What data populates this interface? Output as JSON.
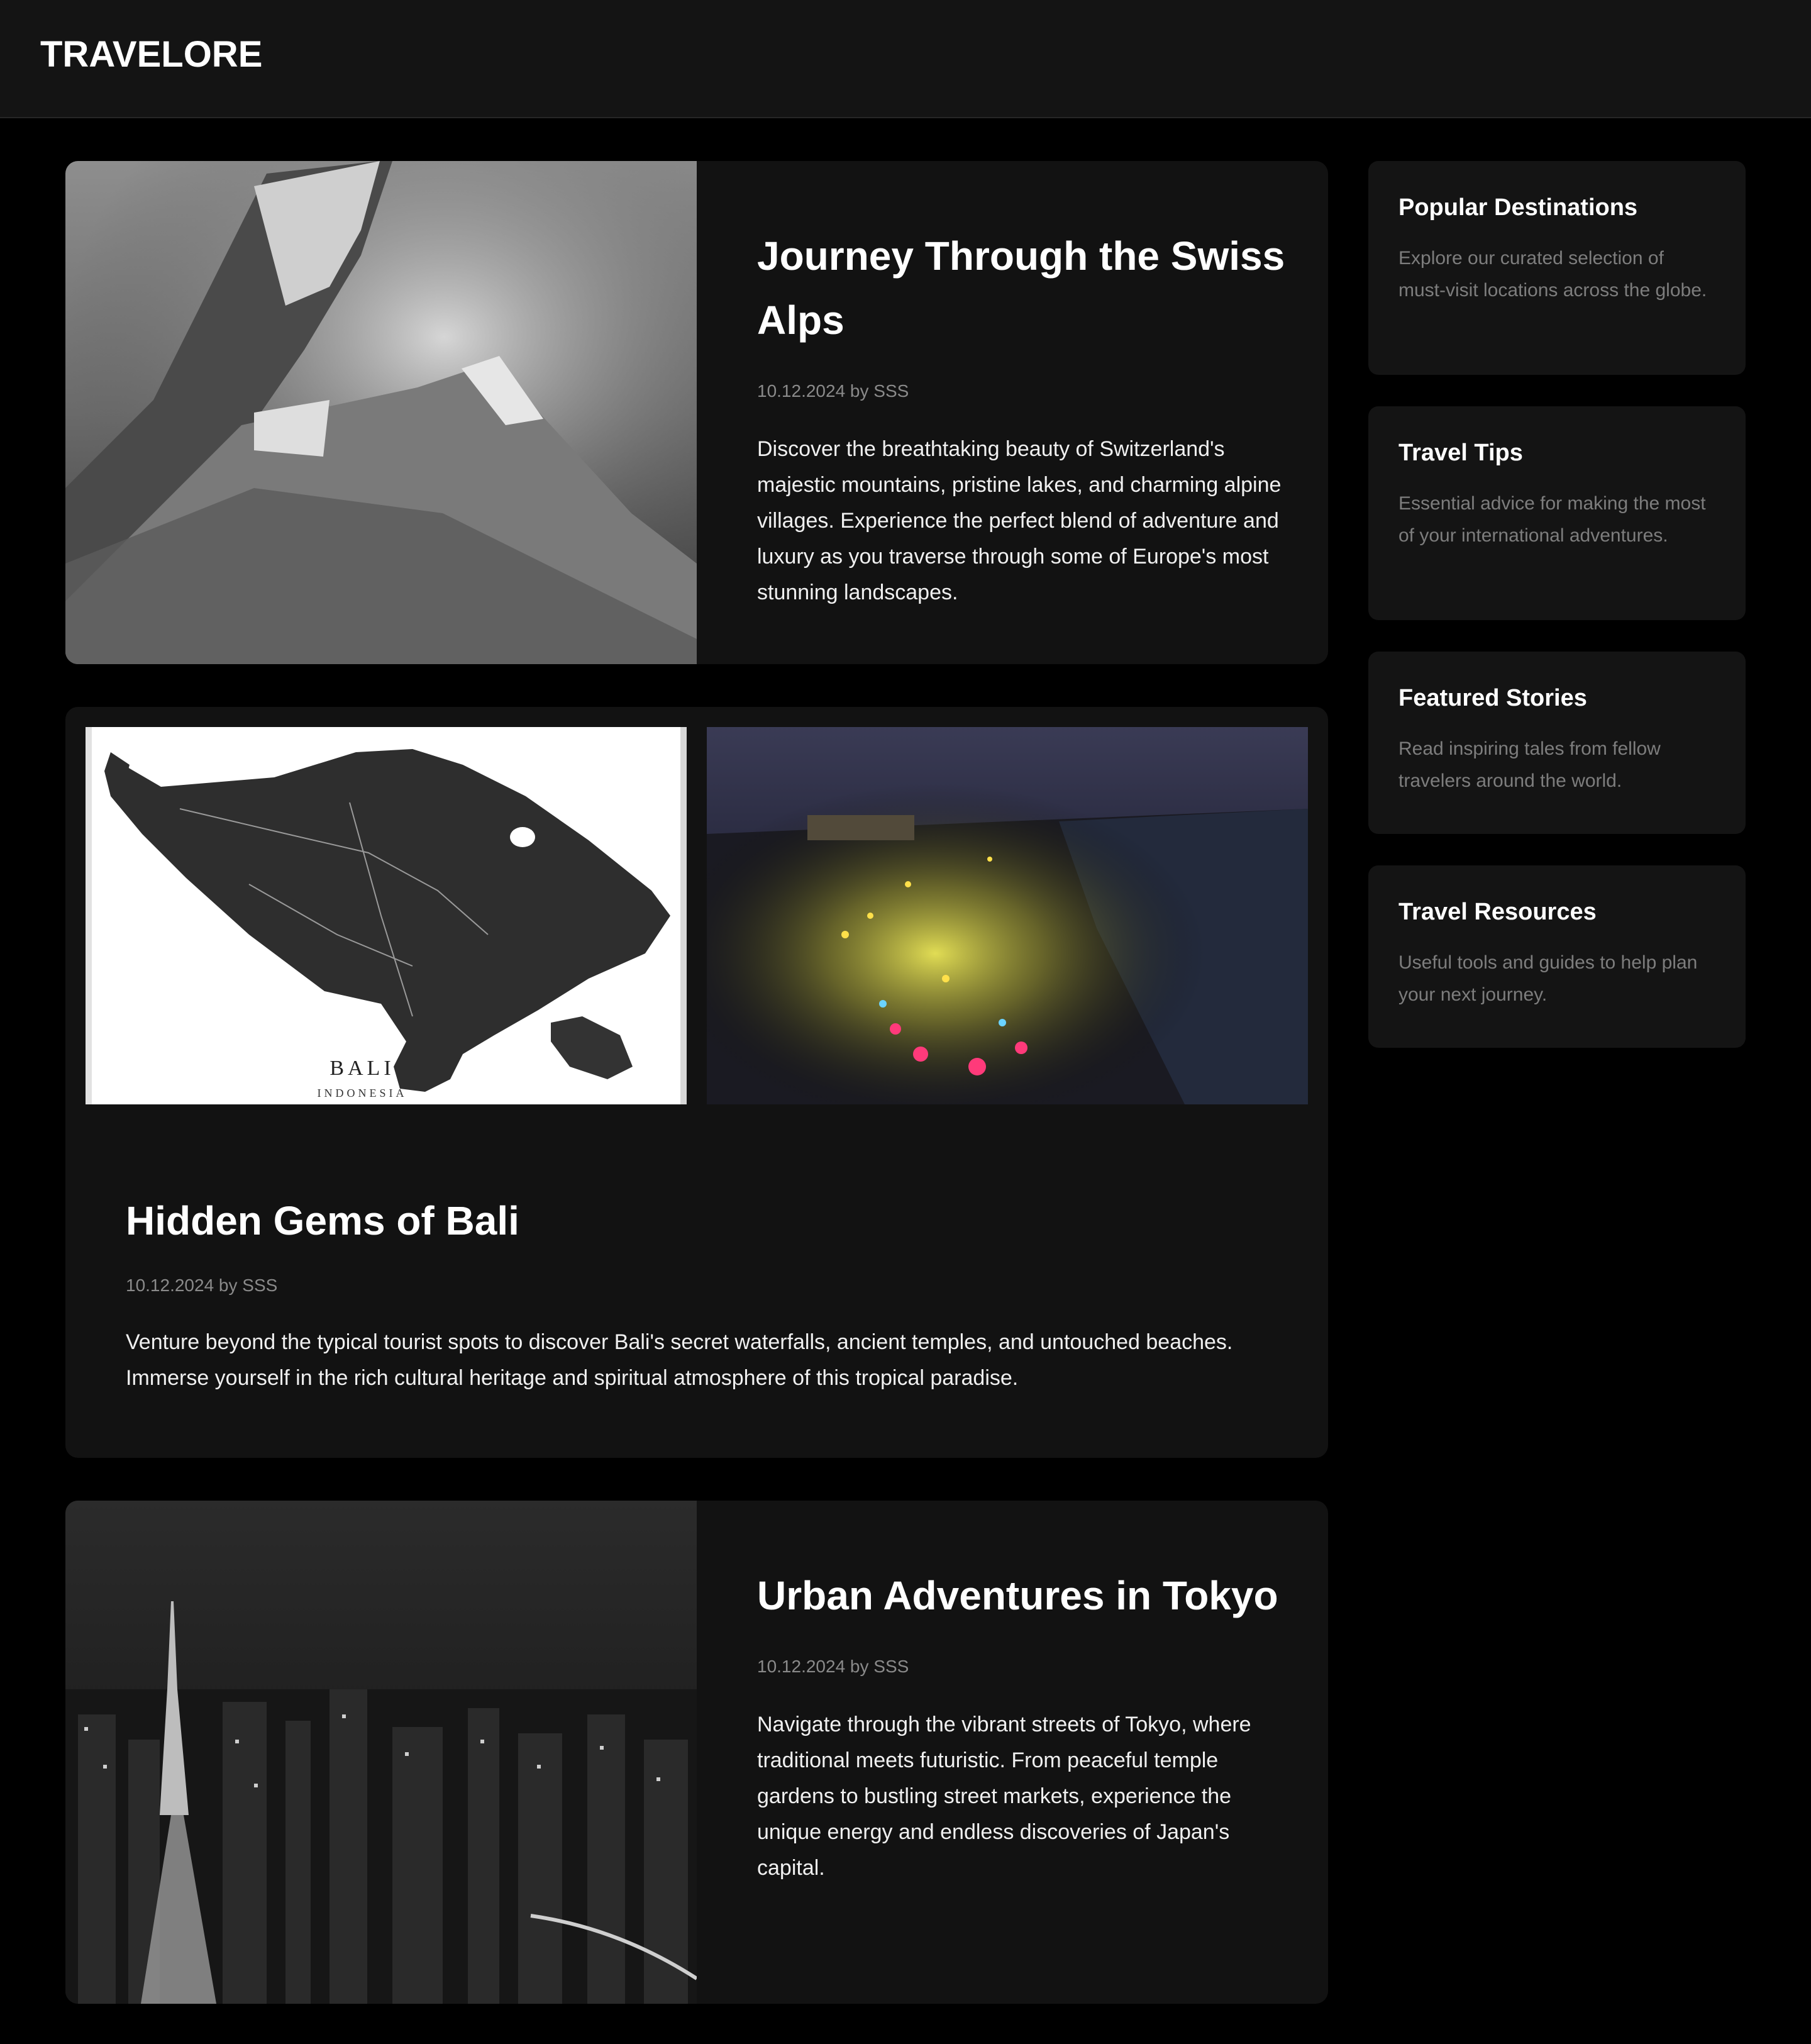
{
  "header": {
    "logo": "TRAVELORE"
  },
  "posts": [
    {
      "title": "Journey Through the Swiss Alps",
      "meta": "10.12.2024 by SSS",
      "excerpt": "Discover the breathtaking beauty of Switzerland's majestic mountains, pristine lakes, and charming alpine villages. Experience the perfect blend of adventure and luxury as you traverse through some of Europe's most stunning landscapes."
    },
    {
      "title": "Hidden Gems of Bali",
      "meta": "10.12.2024 by SSS",
      "excerpt": "Venture beyond the typical tourist spots to discover Bali's secret waterfalls, ancient temples, and untouched beaches. Immerse yourself in the rich cultural heritage and spiritual atmosphere of this tropical paradise.",
      "map_label": "BALI",
      "map_sublabel": "INDONESIA"
    },
    {
      "title": "Urban Adventures in Tokyo",
      "meta": "10.12.2024 by SSS",
      "excerpt": "Navigate through the vibrant streets of Tokyo, where traditional meets futuristic. From peaceful temple gardens to bustling street markets, experience the unique energy and endless discoveries of Japan's capital."
    }
  ],
  "sidebar": [
    {
      "title": "Popular Destinations",
      "desc": "Explore our curated selection of must-visit locations across the globe."
    },
    {
      "title": "Travel Tips",
      "desc": "Essential advice for making the most of your international adventures."
    },
    {
      "title": "Featured Stories",
      "desc": "Read inspiring tales from fellow travelers around the world."
    },
    {
      "title": "Travel Resources",
      "desc": "Useful tools and guides to help plan your next journey."
    }
  ]
}
